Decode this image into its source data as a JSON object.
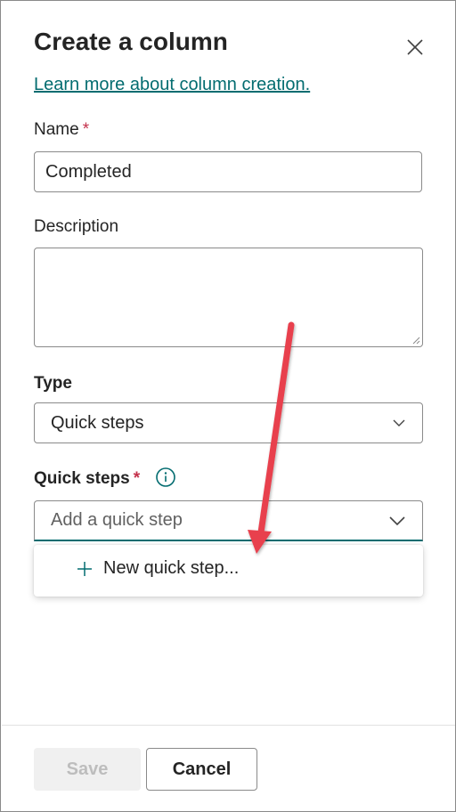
{
  "panel": {
    "title": "Create a column",
    "learn_more_link": "Learn more about column creation.",
    "close_icon": "close-icon"
  },
  "name_field": {
    "label": "Name",
    "required_marker": "*",
    "value": "Completed"
  },
  "description_field": {
    "label": "Description",
    "value": ""
  },
  "type_field": {
    "label": "Type",
    "selected": "Quick steps",
    "icon": "chevron-down-icon"
  },
  "quick_steps_field": {
    "label": "Quick steps",
    "required_marker": "*",
    "info_icon": "info-icon",
    "placeholder": "Add a quick step",
    "icon": "chevron-down-icon"
  },
  "dropdown": {
    "items": [
      {
        "icon": "plus-icon",
        "label": "New quick step..."
      }
    ]
  },
  "footer": {
    "save_label": "Save",
    "cancel_label": "Cancel"
  },
  "colors": {
    "accent": "#036c70",
    "required": "#c4314b",
    "annotation_arrow": "#e8414e"
  }
}
